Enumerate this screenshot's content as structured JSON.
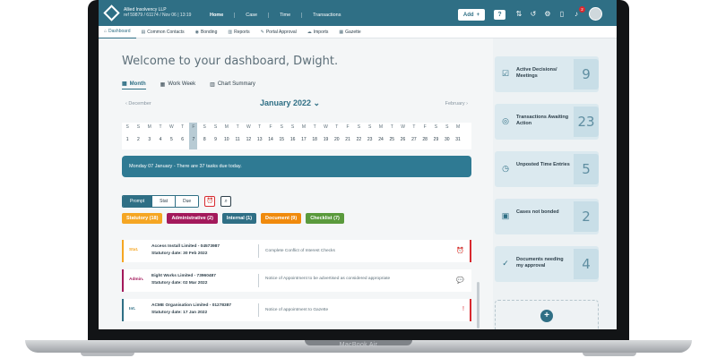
{
  "header": {
    "company_name": "Allied Insolvency LLP",
    "company_sub": "ref 59879 / 61174 / Nov 06 | 13:19",
    "nav": [
      "Home",
      "Case",
      "Time",
      "Transactions"
    ],
    "add_label": "Add",
    "help_label": "?",
    "notification_count": "2"
  },
  "subnav": {
    "tabs": [
      "Dashboard",
      "Common Contacts",
      "Bonding",
      "Reports",
      "Portal Approval",
      "Imports",
      "Gazette"
    ]
  },
  "welcome": "Welcome to your dashboard, Dwight.",
  "view_tabs": [
    "Month",
    "Work Week",
    "Chart Summary"
  ],
  "calendar": {
    "prev": "December",
    "month": "January 2022",
    "next": "February",
    "dow": [
      "S",
      "S",
      "M",
      "T",
      "W",
      "T",
      "F",
      "S",
      "S",
      "M",
      "T",
      "W",
      "T",
      "F",
      "S",
      "S",
      "M",
      "T",
      "W",
      "T",
      "F",
      "S",
      "S",
      "M",
      "T",
      "W",
      "T",
      "F",
      "S",
      "S",
      "M"
    ],
    "days": [
      "1",
      "2",
      "3",
      "4",
      "5",
      "6",
      "7",
      "8",
      "9",
      "10",
      "11",
      "12",
      "13",
      "14",
      "15",
      "16",
      "17",
      "18",
      "19",
      "20",
      "21",
      "22",
      "23",
      "24",
      "25",
      "26",
      "27",
      "28",
      "29",
      "30",
      "31"
    ],
    "today_index": 6
  },
  "banner": "Monday 07 January - There are 37 tasks due today.",
  "filters": {
    "segments": [
      "Prompt",
      "Stat",
      "Due"
    ],
    "chips": [
      {
        "label": "Statutory (18)",
        "color": "#f5a623"
      },
      {
        "label": "Administrative (2)",
        "color": "#a3195b"
      },
      {
        "label": "Internal (1)",
        "color": "#2f6f85"
      },
      {
        "label": "Document (9)",
        "color": "#f08a0c"
      },
      {
        "label": "Checklist (7)",
        "color": "#5a9a3c"
      }
    ]
  },
  "tasks": [
    {
      "tag": "Stat.",
      "name": "Access Install Limited - 04573987",
      "date": "Statutory date: 30 Feb 2022",
      "desc": "Complete Conflict of Interest Checks",
      "color": "#f5a623",
      "action": "alarm-icon",
      "action_glyph": "⏰"
    },
    {
      "tag": "Admin.",
      "name": "Eight Works Limited - 73960487",
      "date": "Statutory date: 02 Mar 2022",
      "desc": "Notice of Appointment to be advertised as considered appropriate",
      "color": "#a3195b",
      "action": "chat-icon",
      "action_glyph": "💬"
    },
    {
      "tag": "Int.",
      "name": "ACME Organisation Limited - 01278387",
      "date": "Statutory date: 17 Jan 2022",
      "desc": "Notice of appointment to Gazette",
      "color": "#2f6f85",
      "action": "alert-icon",
      "action_glyph": "!"
    }
  ],
  "cards": [
    {
      "label": "Active Decisions/ Meetings",
      "value": "9",
      "icon": "checkbox-icon",
      "glyph": "☑"
    },
    {
      "label": "Transactions Awaiting Action",
      "value": "23",
      "icon": "coins-icon",
      "glyph": "◎"
    },
    {
      "label": "Unposted Time Entries",
      "value": "5",
      "icon": "clock-icon",
      "glyph": "◷"
    },
    {
      "label": "Cases not bonded",
      "value": "2",
      "icon": "briefcase-icon",
      "glyph": "▣"
    },
    {
      "label": "Documents needing my approval",
      "value": "4",
      "icon": "check-circle-icon",
      "glyph": "✓"
    }
  ],
  "device_label": "MacBook Air",
  "colors": {
    "primary": "#2f6f85",
    "banner": "#2f7a93",
    "alert": "#d8292f"
  }
}
